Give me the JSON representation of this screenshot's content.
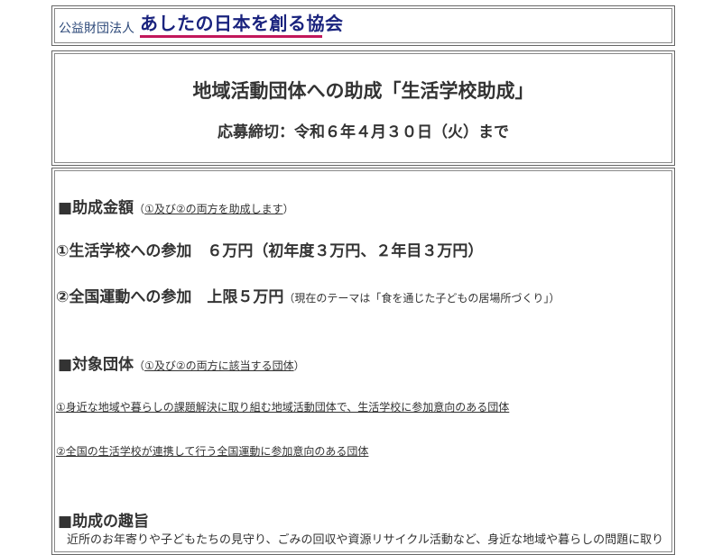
{
  "header": {
    "org_prefix": "公益財団法人",
    "org_name": "あしたの日本を創る協会"
  },
  "title_box": {
    "title": "地域活動団体への助成「生活学校助成」",
    "deadline": "応募締切：令和６年４月３０日（火）まで"
  },
  "grant_amount": {
    "square": "■",
    "heading": "助成金額",
    "note_open": "（",
    "note": "①及び②の両方を助成します",
    "note_close": "）",
    "item1": "①生活学校への参加　６万円（初年度３万円、２年目３万円）",
    "item2": "②全国運動への参加　上限５万円",
    "item2_note": "（現在のテーマは「食を通じた子どもの居場所づくり」）"
  },
  "eligible": {
    "square": "■",
    "heading": "対象団体",
    "note_open": "（",
    "note": "①及び②の両方に該当する団体",
    "note_close": "）",
    "item1": "①身近な地域や暮らしの課題解決に取り組む地域活動団体で、生活学校に参加意向のある団体",
    "item2": "②全国の生活学校が連携して行う全国運動に参加意向のある団体"
  },
  "purpose": {
    "square": "■",
    "heading": "助成の趣旨",
    "body": "近所のお年寄りや子どもたちの見守り、ごみの回収や資源リサイクル活動など、身近な地域や暮らしの問題に取り"
  }
}
